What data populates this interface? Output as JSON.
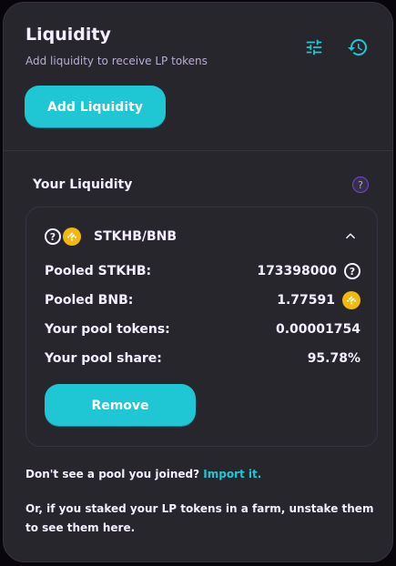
{
  "header": {
    "title": "Liquidity",
    "subtitle": "Add liquidity to receive LP tokens",
    "add_button_label": "Add Liquidity",
    "icons": [
      "settings-tune-icon",
      "history-icon"
    ]
  },
  "section": {
    "title": "Your Liquidity"
  },
  "pool": {
    "pair_name": "STKHB/BNB",
    "rows": [
      {
        "label": "Pooled STKHB:",
        "value": "173398000",
        "icon": "question-icon"
      },
      {
        "label": "Pooled BNB:",
        "value": "1.77591",
        "icon": "bnb-icon"
      },
      {
        "label": "Your pool tokens:",
        "value": "0.00001754"
      },
      {
        "label": "Your pool share:",
        "value": "95.78%"
      }
    ],
    "remove_label": "Remove"
  },
  "footer": {
    "question": "Don't see a pool you joined?",
    "import_link": "Import it.",
    "note": "Or, if you staked your LP tokens in a farm, unstake them to see them here."
  },
  "colors": {
    "accent": "#1fc7d4",
    "card": "#27262c",
    "subtitle": "#b8add2",
    "bnb": "#f0b90b"
  }
}
